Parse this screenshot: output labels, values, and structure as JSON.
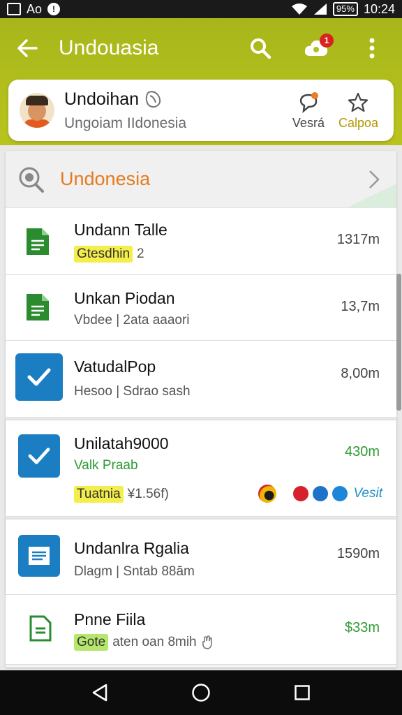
{
  "status_bar": {
    "left_text": "Ao",
    "time": "10:24",
    "battery": "95%"
  },
  "app_bar": {
    "title": "Undouasia",
    "notification_count": "1"
  },
  "profile": {
    "name": "Undoihan",
    "subtitle": "Ungoiam IIdonesia",
    "action_1_label": "Vesrá",
    "action_2_label": "Calpoa"
  },
  "section": {
    "title": "Undonesia"
  },
  "rows": [
    {
      "title": "Undann Talle",
      "tag": "Gtesdhin",
      "sub_extra": "2",
      "value": "1317m"
    },
    {
      "title": "Unkan Piodan",
      "sub": "Vbdee | 2ata aaaori",
      "value": "13,7m"
    },
    {
      "title": "VatudalPop",
      "sub": "Hesoo | Sdrao sash",
      "value": "8,00m"
    },
    {
      "title": "Unilatah9000",
      "sub": "Valk Praab",
      "tag": "Tuatnia",
      "sub_extra": "¥1.56f)",
      "value": "430m",
      "link": "Vesit"
    },
    {
      "title": "Undanlra Rgalia",
      "sub": "Dlagm | Sntab 88ām",
      "value": "1590m"
    },
    {
      "title": "Pnne Fiila",
      "tag": "Gote",
      "sub_extra": "aten oan 8mih",
      "value": "$33m"
    }
  ],
  "colors": {
    "app_bar": "#b2bf1d",
    "accent_orange": "#e57a1f",
    "icon_green": "#2a8c2f",
    "icon_blue": "#1c7ec2"
  }
}
